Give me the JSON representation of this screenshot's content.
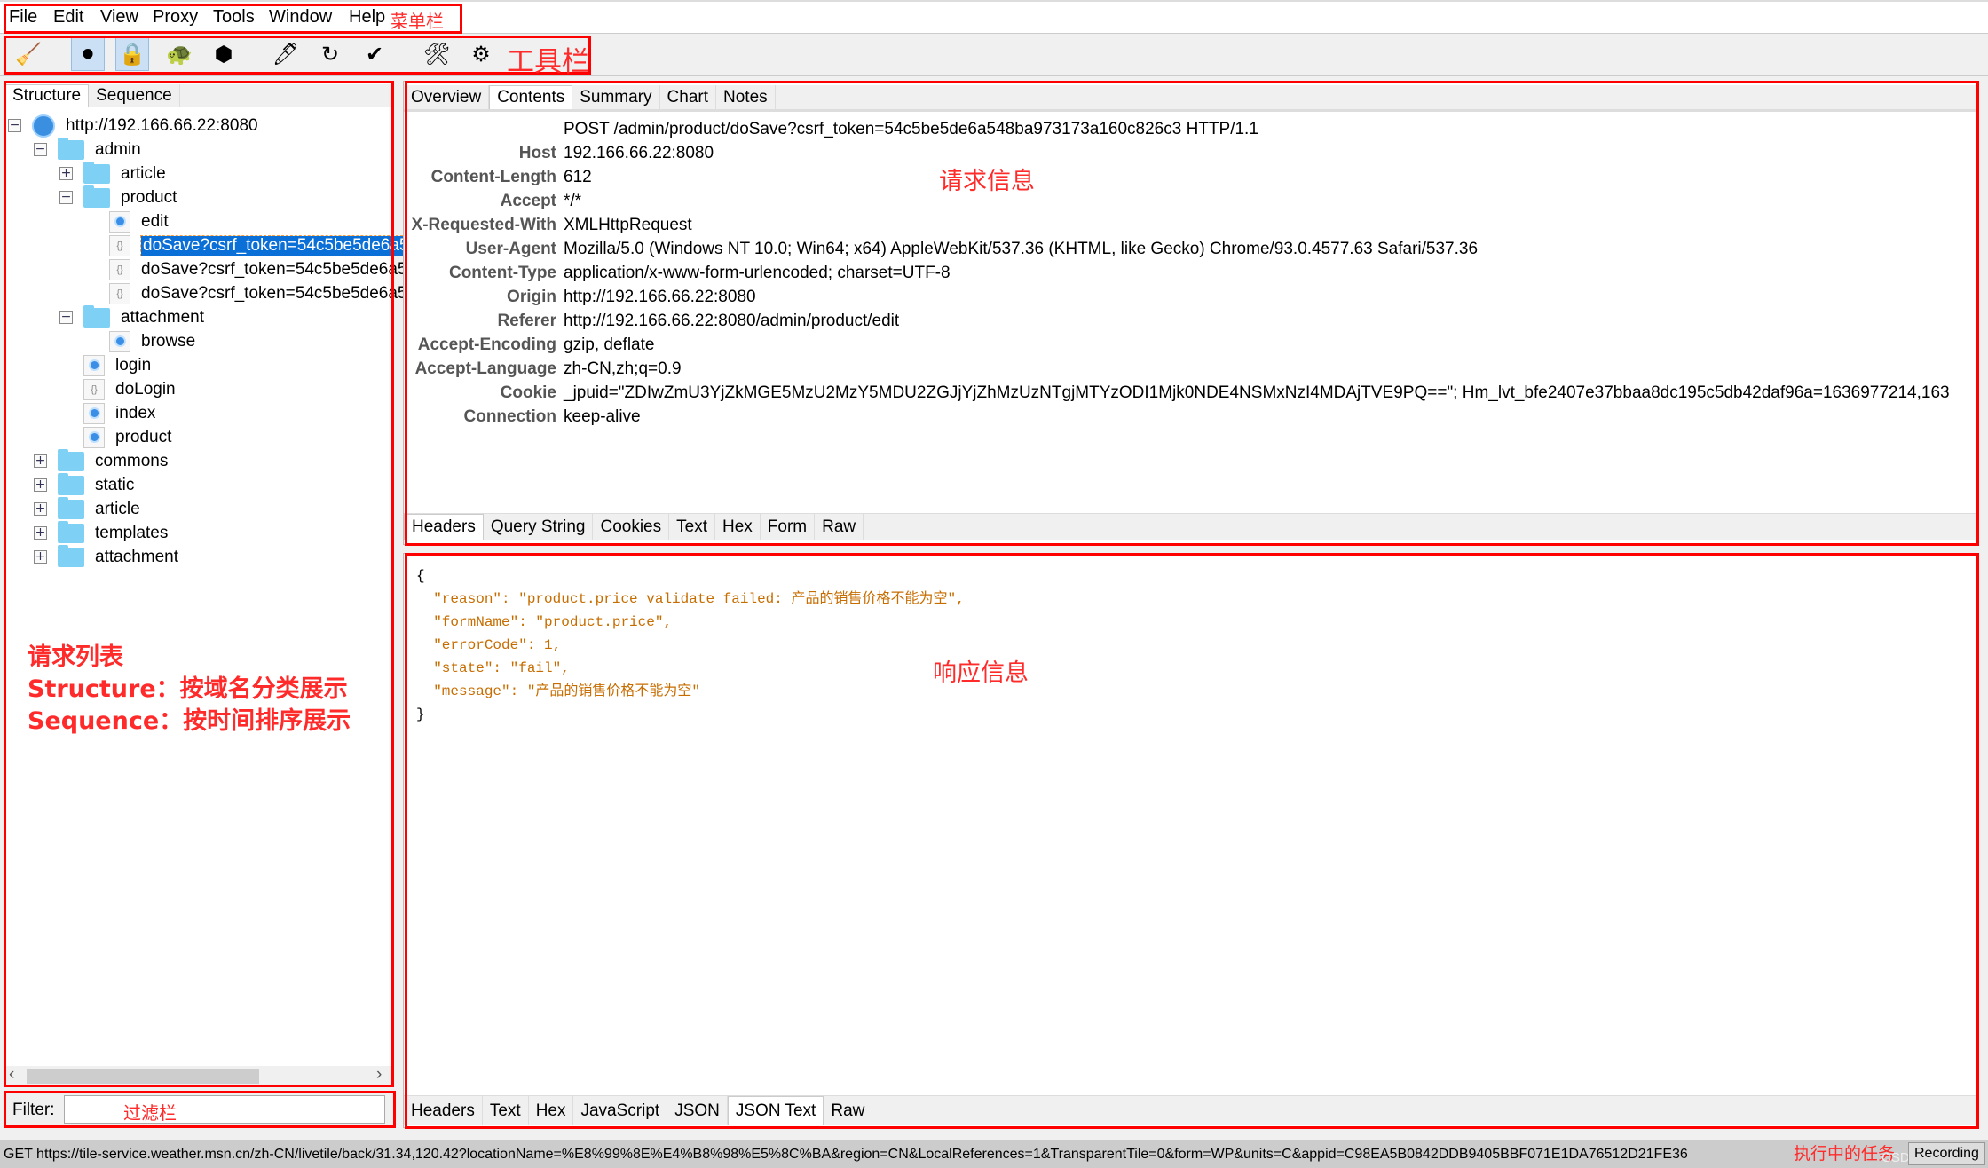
{
  "menu": {
    "items": [
      "File",
      "Edit",
      "View",
      "Proxy",
      "Tools",
      "Window",
      "Help"
    ],
    "annotation": "菜单栏"
  },
  "toolbar": {
    "buttons": [
      {
        "name": "broom-icon",
        "glyph": "🧹",
        "label": "Clear"
      },
      {
        "name": "record-icon",
        "glyph": "⏺",
        "label": "Record",
        "active": true
      },
      {
        "name": "lock-icon",
        "glyph": "🔒",
        "label": "SSL Proxying",
        "active": true
      },
      {
        "name": "turtle-icon",
        "glyph": "🐢",
        "label": "Throttle"
      },
      {
        "name": "stop-hexagon-icon",
        "glyph": "⬢",
        "label": "Breakpoints"
      },
      {
        "name": "pen-icon",
        "glyph": "🖊",
        "label": "Edit"
      },
      {
        "name": "refresh-icon",
        "glyph": "↻",
        "label": "Repeat"
      },
      {
        "name": "check-icon",
        "glyph": "✔",
        "label": "Validate"
      },
      {
        "name": "tools-icon",
        "glyph": "🛠",
        "label": "Tools"
      },
      {
        "name": "gear-icon",
        "glyph": "⚙",
        "label": "Settings"
      }
    ],
    "annotation": "工具栏"
  },
  "left": {
    "tabs": [
      "Structure",
      "Sequence"
    ],
    "selected_tab": "Structure",
    "tree": [
      {
        "label": "http://192.166.66.22:8080",
        "depth": 0,
        "type": "host",
        "toggle": "-"
      },
      {
        "label": "admin",
        "depth": 1,
        "type": "folder",
        "toggle": "-"
      },
      {
        "label": "article",
        "depth": 2,
        "type": "folder",
        "toggle": "+"
      },
      {
        "label": "product",
        "depth": 2,
        "type": "folder",
        "toggle": "-"
      },
      {
        "label": "edit",
        "depth": 3,
        "type": "page"
      },
      {
        "label": "doSave?csrf_token=54c5be5de6a5",
        "depth": 3,
        "type": "json",
        "selected": true
      },
      {
        "label": "doSave?csrf_token=54c5be5de6a5",
        "depth": 3,
        "type": "json"
      },
      {
        "label": "doSave?csrf_token=54c5be5de6a5",
        "depth": 3,
        "type": "json"
      },
      {
        "label": "attachment",
        "depth": 2,
        "type": "folder",
        "toggle": "-"
      },
      {
        "label": "browse",
        "depth": 3,
        "type": "page"
      },
      {
        "label": "login",
        "depth": 2,
        "type": "page"
      },
      {
        "label": "doLogin",
        "depth": 2,
        "type": "json"
      },
      {
        "label": "index",
        "depth": 2,
        "type": "page"
      },
      {
        "label": "product",
        "depth": 2,
        "type": "page"
      },
      {
        "label": "commons",
        "depth": 1,
        "type": "folder",
        "toggle": "+"
      },
      {
        "label": "static",
        "depth": 1,
        "type": "folder",
        "toggle": "+"
      },
      {
        "label": "article",
        "depth": 1,
        "type": "folder",
        "toggle": "+"
      },
      {
        "label": "templates",
        "depth": 1,
        "type": "folder",
        "toggle": "+"
      },
      {
        "label": "attachment",
        "depth": 1,
        "type": "folder",
        "toggle": "+"
      }
    ],
    "annotation": [
      "请求列表",
      "Structure：按域名分类展示",
      "Sequence：按时间排序展示"
    ]
  },
  "filter": {
    "label": "Filter:",
    "value": "",
    "annotation": "过滤栏"
  },
  "request": {
    "tabs": [
      "Overview",
      "Contents",
      "Summary",
      "Chart",
      "Notes"
    ],
    "selected_tab": "Contents",
    "request_line": "POST /admin/product/doSave?csrf_token=54c5be5de6a548ba973173a160c826c3 HTTP/1.1",
    "headers": [
      {
        "k": "Host",
        "v": "192.166.66.22:8080"
      },
      {
        "k": "Content-Length",
        "v": "612"
      },
      {
        "k": "Accept",
        "v": "*/*"
      },
      {
        "k": "X-Requested-With",
        "v": "XMLHttpRequest"
      },
      {
        "k": "User-Agent",
        "v": "Mozilla/5.0 (Windows NT 10.0; Win64; x64) AppleWebKit/537.36 (KHTML, like Gecko) Chrome/93.0.4577.63 Safari/537.36"
      },
      {
        "k": "Content-Type",
        "v": "application/x-www-form-urlencoded; charset=UTF-8"
      },
      {
        "k": "Origin",
        "v": "http://192.166.66.22:8080"
      },
      {
        "k": "Referer",
        "v": "http://192.166.66.22:8080/admin/product/edit"
      },
      {
        "k": "Accept-Encoding",
        "v": "gzip, deflate"
      },
      {
        "k": "Accept-Language",
        "v": "zh-CN,zh;q=0.9"
      },
      {
        "k": "Cookie",
        "v": "_jpuid=\"ZDIwZmU3YjZkMGE5MzU2MzY5MDU2ZGJjYjZhMzUzNTgjMTYzODI1Mjk0NDE4NSMxNzI4MDAjTVE9PQ==\"; Hm_lvt_bfe2407e37bbaa8dc195c5db42daf96a=1636977214,163"
      },
      {
        "k": "Connection",
        "v": "keep-alive"
      }
    ],
    "bottom_tabs": [
      "Headers",
      "Query String",
      "Cookies",
      "Text",
      "Hex",
      "Form",
      "Raw"
    ],
    "selected_bottom_tab": "Headers",
    "annotation": "请求信息"
  },
  "response": {
    "json_lines": [
      "{",
      "  \"reason\": \"product.price validate failed: 产品的销售价格不能为空\",",
      "  \"formName\": \"product.price\",",
      "  \"errorCode\": 1,",
      "  \"state\": \"fail\",",
      "  \"message\": \"产品的销售价格不能为空\"",
      "}"
    ],
    "bottom_tabs": [
      "Headers",
      "Text",
      "Hex",
      "JavaScript",
      "JSON",
      "JSON Text",
      "Raw"
    ],
    "selected_bottom_tab": "JSON Text",
    "annotation": "响应信息"
  },
  "status": {
    "text": "GET https://tile-service.weather.msn.cn/zh-CN/livetile/back/31.34,120.42?locationName=%E8%99%8E%E4%B8%98%E5%8C%BA&region=CN&LocalReferences=1&TransparentTile=0&form=WP&units=C&appid=C98EA5B0842DDB9405BBF071E1DA76512D21FE36",
    "recording": "Recording",
    "annotation": "执行中的任务",
    "watermark": "CSDN @小白典"
  },
  "colors": {
    "annotation": "#ff0000",
    "selection": "#0a6fd6",
    "json_string": "#c76d00"
  }
}
